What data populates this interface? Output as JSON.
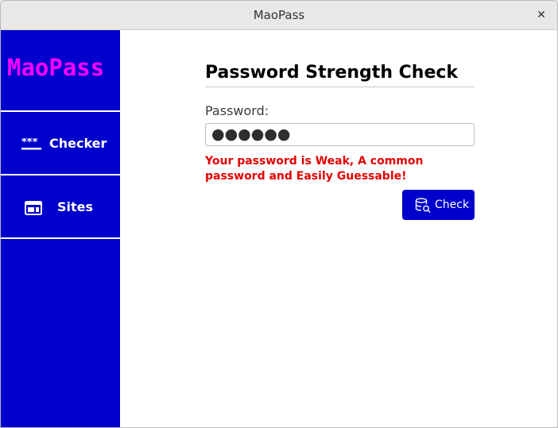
{
  "window": {
    "title": "MaoPass",
    "close_glyph": "✕"
  },
  "sidebar": {
    "brand": "MaoPass",
    "items": [
      {
        "label": "Checker",
        "icon": "password-dots-icon"
      },
      {
        "label": "Sites",
        "icon": "web-page-icon"
      }
    ]
  },
  "main": {
    "heading": "Password Strength Check",
    "password_label": "Password:",
    "password_value": "●●●●●●",
    "result_message": "Your password is  Weak, A common password and Easily Guessable!",
    "check_button": {
      "label": "Check",
      "icon": "database-search-icon"
    }
  },
  "colors": {
    "sidebar_bg": "#0000cc",
    "brand_text": "#ff00ff",
    "error_text": "#e50000",
    "button_bg": "#0000cc"
  }
}
